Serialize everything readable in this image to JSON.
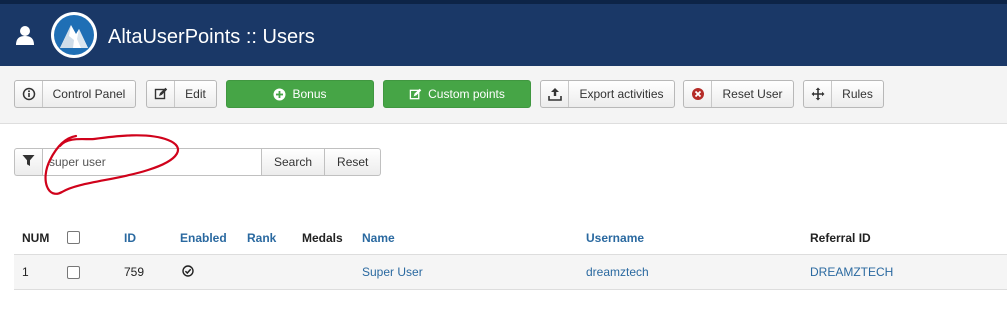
{
  "header": {
    "title": "AltaUserPoints :: Users",
    "user_icon": "user-icon",
    "logo_icon": "altauserpoints-logo"
  },
  "toolbar": {
    "buttons": [
      {
        "label": "Control Panel",
        "icon": "info-icon"
      },
      {
        "label": "Edit",
        "icon": "edit-icon"
      },
      {
        "label": "Bonus",
        "icon": "plus-circle-icon"
      },
      {
        "label": "Custom points",
        "icon": "edit-icon"
      },
      {
        "label": "Export activities",
        "icon": "upload-icon"
      },
      {
        "label": "Reset User",
        "icon": "remove-circle-icon"
      },
      {
        "label": "Rules",
        "icon": "move-icon"
      }
    ]
  },
  "search": {
    "value": "super user",
    "search_label": "Search",
    "reset_label": "Reset",
    "filter_icon": "filter-icon"
  },
  "table": {
    "columns": [
      "NUM",
      "ID",
      "Enabled",
      "Rank",
      "Medals",
      "Name",
      "Username",
      "Referral ID"
    ],
    "rows": [
      {
        "num": "1",
        "id": "759",
        "enabled_icon": "check-circle-icon",
        "rank": "",
        "medals": "",
        "name": "Super User",
        "username": "dreamztech",
        "referral_id": "DREAMZTECH"
      }
    ]
  },
  "colors": {
    "header_bg": "#1a3867",
    "button_green": "#46a546",
    "link": "#2a69a0",
    "annotation": "#d0021b"
  }
}
